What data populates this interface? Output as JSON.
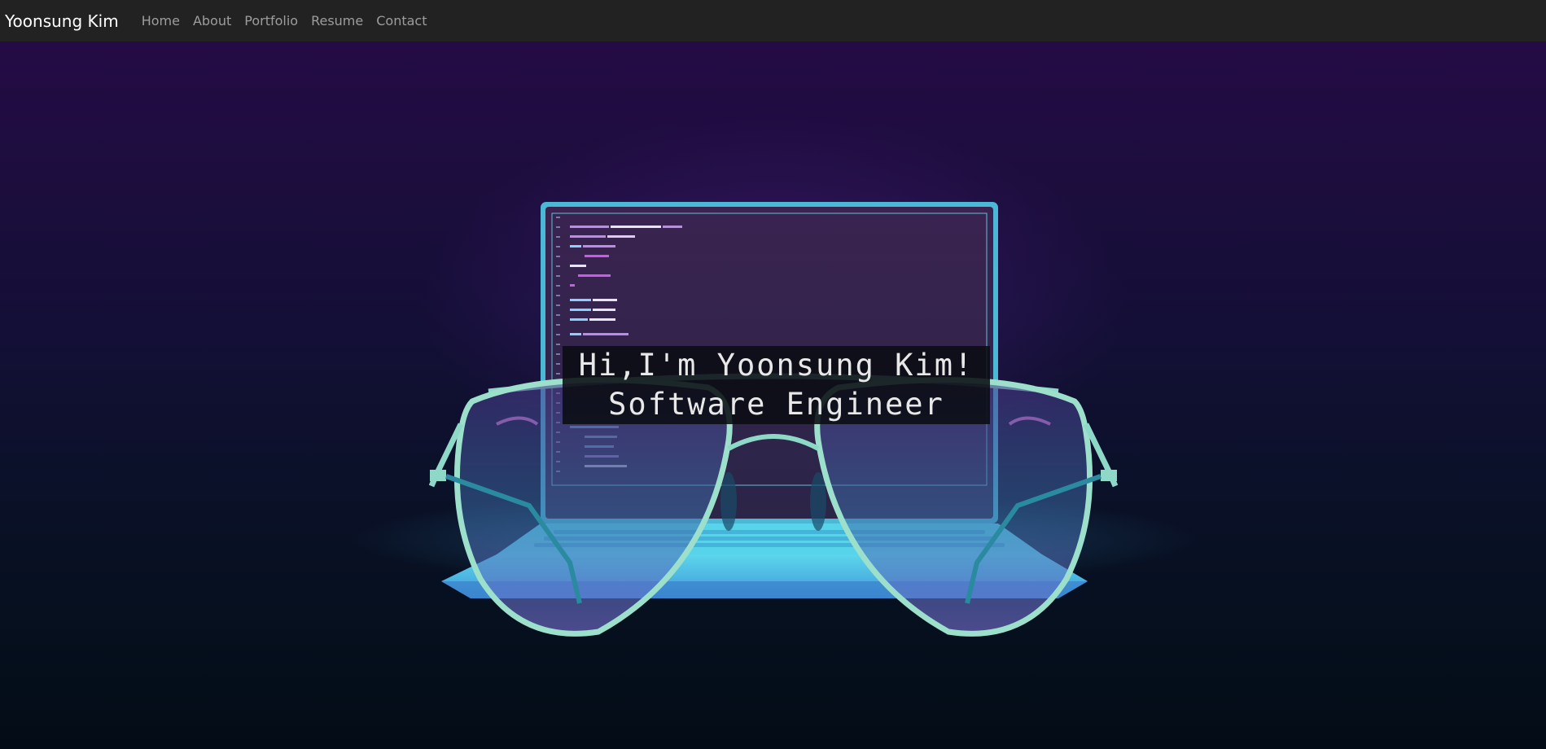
{
  "navbar": {
    "brand": "Yoonsung Kim",
    "links": [
      "Home",
      "About",
      "Portfolio",
      "Resume",
      "Contact"
    ]
  },
  "hero": {
    "greeting": "Hi,I'm Yoonsung Kim!",
    "role": "Software Engineer"
  },
  "colors": {
    "navbar_bg": "#222222",
    "nav_link": "#9d9d9d",
    "hero_top": "#240b45",
    "hero_bottom": "#030c16",
    "laptop_frame": "#6fd3ea",
    "glasses_frame": "#8ed8c8"
  },
  "icons": [
    "laptop-illustration",
    "aviator-glasses-illustration"
  ]
}
